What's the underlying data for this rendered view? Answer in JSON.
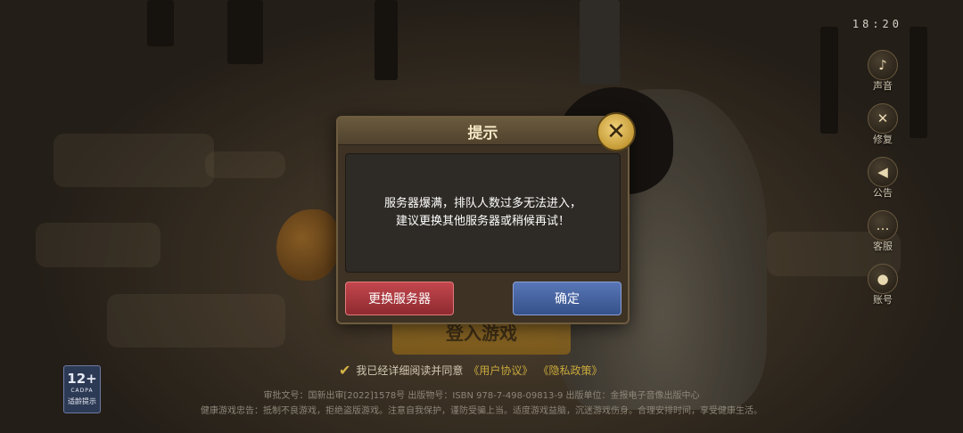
{
  "status_bar": {
    "clock": "18:20"
  },
  "sidebar": {
    "items": [
      {
        "label": "声音",
        "icon": "speaker-icon"
      },
      {
        "label": "修复",
        "icon": "wrench-icon"
      },
      {
        "label": "公告",
        "icon": "megaphone-icon"
      },
      {
        "label": "客服",
        "icon": "chat-bubble-icon"
      },
      {
        "label": "账号",
        "icon": "user-icon"
      }
    ]
  },
  "login": {
    "button_label": "登入游戏",
    "agreement_prefix": "我已经详细阅读并同意",
    "user_agreement": "《用户协议》",
    "privacy_policy": "《隐私政策》"
  },
  "age_rating": {
    "age": "12+",
    "org": "CADPA",
    "tip": "适龄提示"
  },
  "footer": {
    "line1": "审批文号：国新出审[2022]1578号  出版物号：ISBN 978-7-498-09813-9  出版单位：金报电子音像出版中心",
    "line2": "健康游戏忠告：抵制不良游戏，拒绝盗版游戏。注意自我保护，谨防受骗上当。适度游戏益脑，沉迷游戏伤身。合理安排时间，享受健康生活。"
  },
  "dialog": {
    "title": "提示",
    "message_line1": "服务器爆满，排队人数过多无法进入，",
    "message_line2": "建议更换其他服务器或稍候再试！",
    "change_server_label": "更换服务器",
    "confirm_label": "确定"
  },
  "colors": {
    "dialog_bg": "#3d3224",
    "change_server_red": "#c3474d",
    "confirm_blue": "#5876b6",
    "gold_accent": "#c9a93c"
  }
}
